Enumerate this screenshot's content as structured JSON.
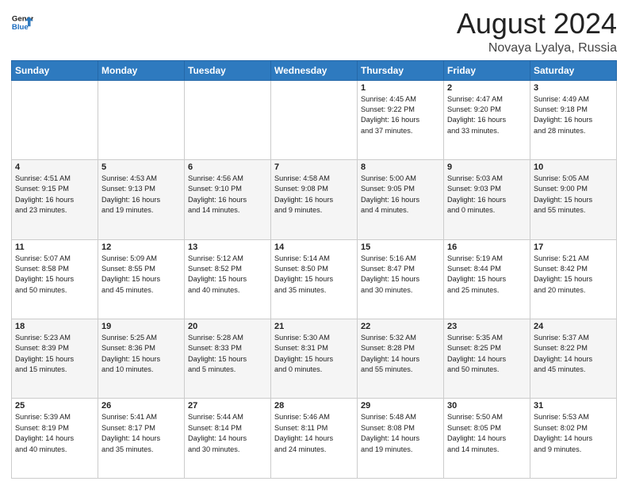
{
  "header": {
    "logo_line1": "General",
    "logo_line2": "Blue",
    "main_title": "August 2024",
    "sub_title": "Novaya Lyalya, Russia"
  },
  "weekdays": [
    "Sunday",
    "Monday",
    "Tuesday",
    "Wednesday",
    "Thursday",
    "Friday",
    "Saturday"
  ],
  "weeks": [
    [
      {
        "day": "",
        "info": ""
      },
      {
        "day": "",
        "info": ""
      },
      {
        "day": "",
        "info": ""
      },
      {
        "day": "",
        "info": ""
      },
      {
        "day": "1",
        "info": "Sunrise: 4:45 AM\nSunset: 9:22 PM\nDaylight: 16 hours\nand 37 minutes."
      },
      {
        "day": "2",
        "info": "Sunrise: 4:47 AM\nSunset: 9:20 PM\nDaylight: 16 hours\nand 33 minutes."
      },
      {
        "day": "3",
        "info": "Sunrise: 4:49 AM\nSunset: 9:18 PM\nDaylight: 16 hours\nand 28 minutes."
      }
    ],
    [
      {
        "day": "4",
        "info": "Sunrise: 4:51 AM\nSunset: 9:15 PM\nDaylight: 16 hours\nand 23 minutes."
      },
      {
        "day": "5",
        "info": "Sunrise: 4:53 AM\nSunset: 9:13 PM\nDaylight: 16 hours\nand 19 minutes."
      },
      {
        "day": "6",
        "info": "Sunrise: 4:56 AM\nSunset: 9:10 PM\nDaylight: 16 hours\nand 14 minutes."
      },
      {
        "day": "7",
        "info": "Sunrise: 4:58 AM\nSunset: 9:08 PM\nDaylight: 16 hours\nand 9 minutes."
      },
      {
        "day": "8",
        "info": "Sunrise: 5:00 AM\nSunset: 9:05 PM\nDaylight: 16 hours\nand 4 minutes."
      },
      {
        "day": "9",
        "info": "Sunrise: 5:03 AM\nSunset: 9:03 PM\nDaylight: 16 hours\nand 0 minutes."
      },
      {
        "day": "10",
        "info": "Sunrise: 5:05 AM\nSunset: 9:00 PM\nDaylight: 15 hours\nand 55 minutes."
      }
    ],
    [
      {
        "day": "11",
        "info": "Sunrise: 5:07 AM\nSunset: 8:58 PM\nDaylight: 15 hours\nand 50 minutes."
      },
      {
        "day": "12",
        "info": "Sunrise: 5:09 AM\nSunset: 8:55 PM\nDaylight: 15 hours\nand 45 minutes."
      },
      {
        "day": "13",
        "info": "Sunrise: 5:12 AM\nSunset: 8:52 PM\nDaylight: 15 hours\nand 40 minutes."
      },
      {
        "day": "14",
        "info": "Sunrise: 5:14 AM\nSunset: 8:50 PM\nDaylight: 15 hours\nand 35 minutes."
      },
      {
        "day": "15",
        "info": "Sunrise: 5:16 AM\nSunset: 8:47 PM\nDaylight: 15 hours\nand 30 minutes."
      },
      {
        "day": "16",
        "info": "Sunrise: 5:19 AM\nSunset: 8:44 PM\nDaylight: 15 hours\nand 25 minutes."
      },
      {
        "day": "17",
        "info": "Sunrise: 5:21 AM\nSunset: 8:42 PM\nDaylight: 15 hours\nand 20 minutes."
      }
    ],
    [
      {
        "day": "18",
        "info": "Sunrise: 5:23 AM\nSunset: 8:39 PM\nDaylight: 15 hours\nand 15 minutes."
      },
      {
        "day": "19",
        "info": "Sunrise: 5:25 AM\nSunset: 8:36 PM\nDaylight: 15 hours\nand 10 minutes."
      },
      {
        "day": "20",
        "info": "Sunrise: 5:28 AM\nSunset: 8:33 PM\nDaylight: 15 hours\nand 5 minutes."
      },
      {
        "day": "21",
        "info": "Sunrise: 5:30 AM\nSunset: 8:31 PM\nDaylight: 15 hours\nand 0 minutes."
      },
      {
        "day": "22",
        "info": "Sunrise: 5:32 AM\nSunset: 8:28 PM\nDaylight: 14 hours\nand 55 minutes."
      },
      {
        "day": "23",
        "info": "Sunrise: 5:35 AM\nSunset: 8:25 PM\nDaylight: 14 hours\nand 50 minutes."
      },
      {
        "day": "24",
        "info": "Sunrise: 5:37 AM\nSunset: 8:22 PM\nDaylight: 14 hours\nand 45 minutes."
      }
    ],
    [
      {
        "day": "25",
        "info": "Sunrise: 5:39 AM\nSunset: 8:19 PM\nDaylight: 14 hours\nand 40 minutes."
      },
      {
        "day": "26",
        "info": "Sunrise: 5:41 AM\nSunset: 8:17 PM\nDaylight: 14 hours\nand 35 minutes."
      },
      {
        "day": "27",
        "info": "Sunrise: 5:44 AM\nSunset: 8:14 PM\nDaylight: 14 hours\nand 30 minutes."
      },
      {
        "day": "28",
        "info": "Sunrise: 5:46 AM\nSunset: 8:11 PM\nDaylight: 14 hours\nand 24 minutes."
      },
      {
        "day": "29",
        "info": "Sunrise: 5:48 AM\nSunset: 8:08 PM\nDaylight: 14 hours\nand 19 minutes."
      },
      {
        "day": "30",
        "info": "Sunrise: 5:50 AM\nSunset: 8:05 PM\nDaylight: 14 hours\nand 14 minutes."
      },
      {
        "day": "31",
        "info": "Sunrise: 5:53 AM\nSunset: 8:02 PM\nDaylight: 14 hours\nand 9 minutes."
      }
    ]
  ]
}
